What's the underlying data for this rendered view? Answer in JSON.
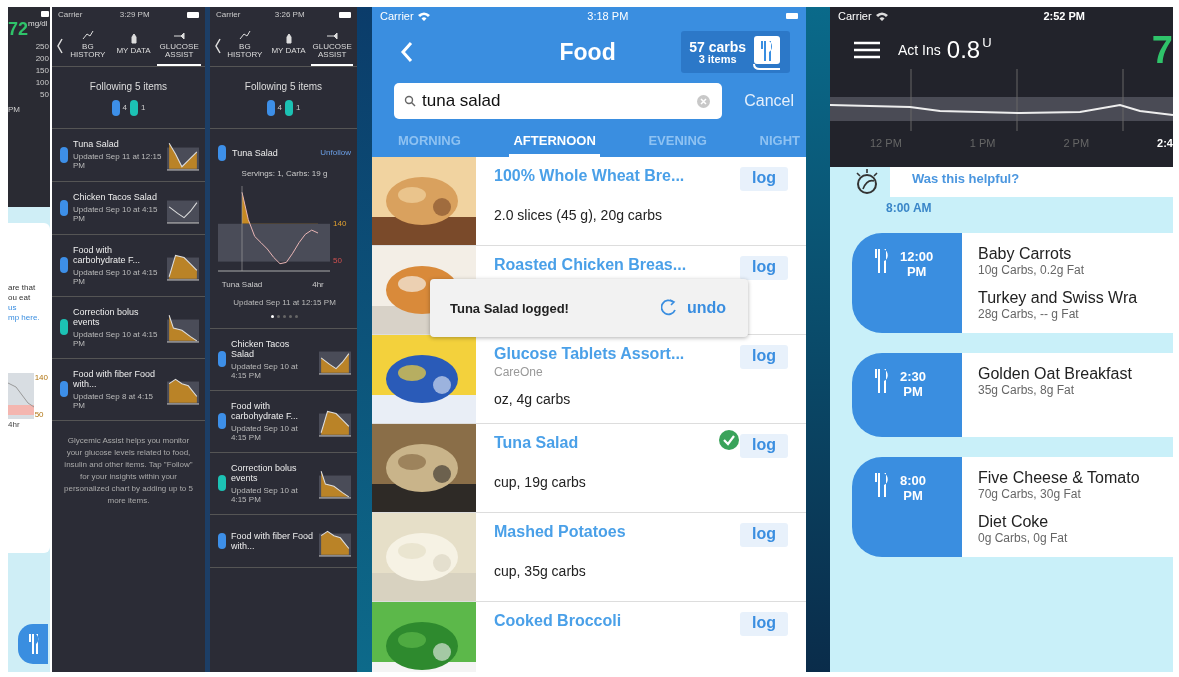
{
  "glucose_panel": {
    "reading": "72",
    "unit": "mg/dl",
    "axis": [
      "250",
      "200",
      "150",
      "100",
      "50"
    ],
    "time": "PM",
    "note_lines": [
      "are that",
      "ou eat",
      "us",
      "mp here."
    ],
    "chart_labels": [
      "140",
      "50",
      "4hr"
    ]
  },
  "assist_list_panel": {
    "carrier": "Carrier",
    "time": "3:29 PM",
    "tabs": [
      {
        "label": "BG HISTORY",
        "selected": false
      },
      {
        "label": "MY DATA",
        "selected": false
      },
      {
        "label": "GLUCOSE ASSIST",
        "selected": true
      }
    ],
    "heading": "Following 5 items",
    "counts": [
      {
        "kind": "food",
        "count": "4"
      },
      {
        "kind": "correction",
        "count": "1"
      }
    ],
    "rows": [
      {
        "kind": "food",
        "title": "Tuna Salad",
        "updated": "Updated Sep 11 at 12:15 PM"
      },
      {
        "kind": "food",
        "title": "Chicken Tacos Salad",
        "updated": "Updated Sep 10 at 4:15 PM"
      },
      {
        "kind": "food",
        "title": "Food with carbohydrate F...",
        "updated": "Updated Sep 10 at 4:15 PM"
      },
      {
        "kind": "correction",
        "title": "Correction bolus events",
        "updated": "Updated Sep 10 at 4:15 PM"
      },
      {
        "kind": "food",
        "title": "Food with fiber Food with...",
        "updated": "Updated Sep 8 at 4:15 PM"
      }
    ],
    "footer": "Glycemic Assist helps you monitor your glucose levels related to food, insulin and other items. Tap \"Follow\" for your insights within your personalized chart by adding up to 5 more items."
  },
  "assist_detail_panel": {
    "carrier": "Carrier",
    "time": "3:26 PM",
    "tabs": [
      {
        "label": "BG HISTORY",
        "selected": false
      },
      {
        "label": "MY DATA",
        "selected": false
      },
      {
        "label": "GLUCOSE ASSIST",
        "selected": true
      }
    ],
    "heading": "Following 5 items",
    "counts": [
      {
        "kind": "food",
        "count": "4"
      },
      {
        "kind": "correction",
        "count": "1"
      }
    ],
    "detail": {
      "kind": "food",
      "title": "Tuna Salad",
      "action": "Unfollow",
      "servings": "Servings: 1, Carbs: 19 g",
      "chart_data": {
        "type": "line",
        "categories": [
          "Tuna Salad",
          null,
          null,
          null,
          null,
          null,
          null,
          null,
          null,
          null,
          null,
          null,
          "4hr"
        ],
        "series": [
          {
            "color": "#e9b5b5",
            "values": [
              215,
              150,
              110,
              95,
              80,
              60,
              45,
              48,
              70,
              95,
              115,
              125,
              118
            ]
          }
        ],
        "ylim": [
          30,
          230
        ],
        "bands": [
          {
            "axis": "y",
            "from": 50,
            "to": 140,
            "color": "#4a4c58"
          }
        ],
        "yticks": [
          {
            "value": 140,
            "label": "140"
          },
          {
            "value": 50,
            "label": "50"
          }
        ]
      },
      "updated": "Updated Sep 11 at 12:15 PM",
      "pages": [
        {
          "selected": true
        },
        {
          "selected": false
        },
        {
          "selected": false
        },
        {
          "selected": false
        },
        {
          "selected": false
        }
      ]
    },
    "rows": [
      {
        "kind": "food",
        "title": "Chicken Tacos Salad",
        "updated": "Updated Sep 10 at 4:15 PM"
      },
      {
        "kind": "food",
        "title": "Food with carbohydrate F...",
        "updated": "Updated Sep 10 at 4:15 PM"
      },
      {
        "kind": "correction",
        "title": "Correction bolus events",
        "updated": "Updated Sep 10 at 4:15 PM"
      },
      {
        "kind": "food",
        "title": "Food with fiber Food with..."
      }
    ]
  },
  "food_panel": {
    "carrier": "Carrier",
    "time": "3:18 PM",
    "title": "Food",
    "summary": [
      "57 carbs",
      "3 items"
    ],
    "search": {
      "value": "tuna salad"
    },
    "cancel": "Cancel",
    "tabs": [
      {
        "label": "MORNING",
        "selected": false
      },
      {
        "label": "AFTERNOON",
        "selected": true
      },
      {
        "label": "EVENING",
        "selected": false
      },
      {
        "label": "NIGHT",
        "selected": false
      }
    ],
    "items": [
      {
        "name": "100% Whole Wheat Bre...",
        "detail": "2.0 slices (45 g), 20g carbs",
        "logged": false,
        "button": "log"
      },
      {
        "name": "Roasted Chicken Breas...",
        "logged": false,
        "button": "log"
      },
      {
        "name": "Glucose Tablets Assort...",
        "brand": "CareOne",
        "detail": "oz, 4g carbs",
        "logged": false,
        "button": "log"
      },
      {
        "name": "Tuna Salad",
        "detail": "cup, 19g carbs",
        "logged": true,
        "button": "log"
      },
      {
        "name": "Mashed Potatoes",
        "detail": "cup, 35g carbs",
        "logged": false,
        "button": "log"
      },
      {
        "name": "Cooked Broccoli",
        "logged": false,
        "button": "log"
      }
    ],
    "toast": {
      "message": "Tuna Salad logged!",
      "action": "undo"
    }
  },
  "timeline_panel": {
    "carrier": "Carrier",
    "time": "2:52 PM",
    "active_label": "Act Ins",
    "active_value": "0.8",
    "active_unit": "U",
    "glucose": "7",
    "ticks": [
      "12 PM",
      "1 PM",
      "2 PM",
      "2:4"
    ],
    "prompt": "Was this helpful?",
    "prompt_time": "8:00 AM",
    "meals": [
      {
        "time": "12:00",
        "period": "PM",
        "foods": [
          {
            "name": "Baby Carrots",
            "info": "10g Carbs, 0.2g Fat"
          },
          {
            "name": "Turkey and Swiss Wra",
            "info": "28g Carbs, -- g Fat"
          }
        ]
      },
      {
        "time": "2:30",
        "period": "PM",
        "foods": [
          {
            "name": "Golden Oat Breakfast",
            "info": "35g Carbs, 8g Fat"
          }
        ]
      },
      {
        "time": "8:00",
        "period": "PM",
        "foods": [
          {
            "name": "Five Cheese & Tomato",
            "info": "70g Carbs, 30g Fat"
          },
          {
            "name": "Diet Coke",
            "info": "0g Carbs, 0g Fat"
          }
        ]
      }
    ]
  }
}
